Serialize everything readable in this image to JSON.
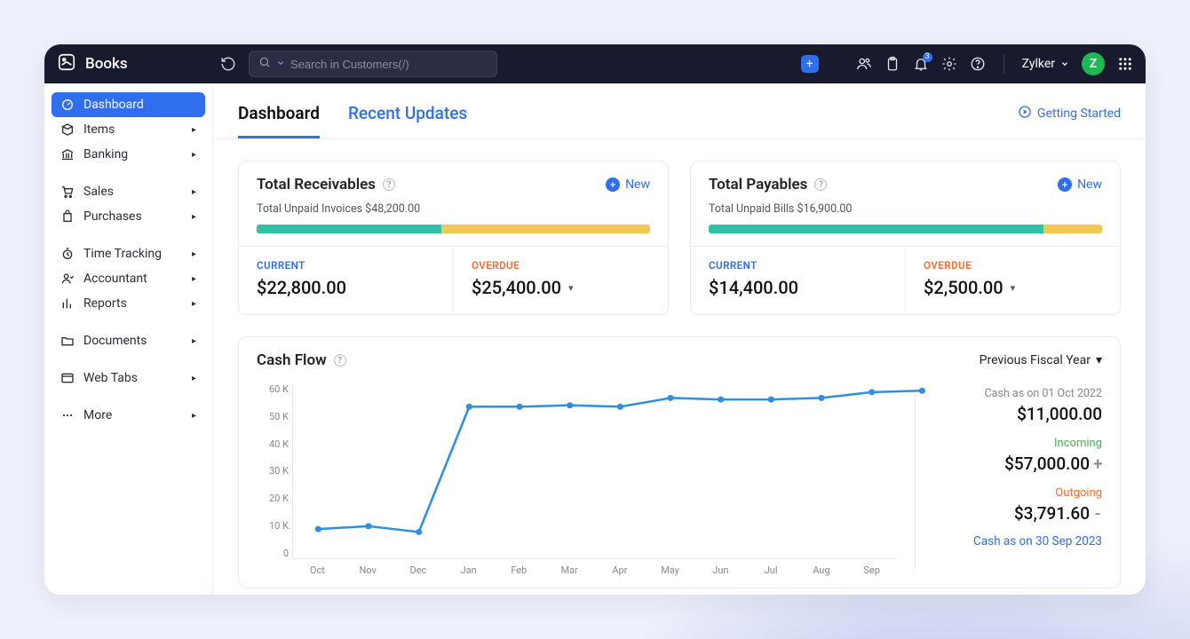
{
  "brand": {
    "name": "Books"
  },
  "search": {
    "placeholder": "Search in Customers(/)"
  },
  "header": {
    "org_name": "Zylker",
    "avatar_initial": "Z",
    "notification_count": "3"
  },
  "sidebar": {
    "groups": [
      {
        "items": [
          {
            "key": "dashboard",
            "label": "Dashboard",
            "expandable": false,
            "active": true
          },
          {
            "key": "items",
            "label": "Items",
            "expandable": true
          },
          {
            "key": "banking",
            "label": "Banking",
            "expandable": true
          }
        ]
      },
      {
        "items": [
          {
            "key": "sales",
            "label": "Sales",
            "expandable": true
          },
          {
            "key": "purchases",
            "label": "Purchases",
            "expandable": true
          }
        ]
      },
      {
        "items": [
          {
            "key": "time-tracking",
            "label": "Time Tracking",
            "expandable": true
          },
          {
            "key": "accountant",
            "label": "Accountant",
            "expandable": true
          },
          {
            "key": "reports",
            "label": "Reports",
            "expandable": true
          }
        ]
      },
      {
        "items": [
          {
            "key": "documents",
            "label": "Documents",
            "expandable": true
          }
        ]
      },
      {
        "items": [
          {
            "key": "web-tabs",
            "label": "Web Tabs",
            "expandable": true
          }
        ]
      },
      {
        "items": [
          {
            "key": "more",
            "label": "More",
            "expandable": true
          }
        ]
      }
    ]
  },
  "tabs": {
    "dashboard": "Dashboard",
    "recent_updates": "Recent Updates",
    "getting_started": "Getting Started"
  },
  "receivables": {
    "title": "Total Receivables",
    "new": "New",
    "sub_label": "Total Unpaid Invoices $48,200.00",
    "current_label": "CURRENT",
    "current_amount": "$22,800.00",
    "overdue_label": "OVERDUE",
    "overdue_amount": "$25,400.00",
    "current_pct": 47
  },
  "payables": {
    "title": "Total Payables",
    "new": "New",
    "sub_label": "Total Unpaid Bills $16,900.00",
    "current_label": "CURRENT",
    "current_amount": "$14,400.00",
    "overdue_label": "OVERDUE",
    "overdue_amount": "$2,500.00",
    "current_pct": 85
  },
  "cashflow": {
    "title": "Cash Flow",
    "period": "Previous Fiscal Year",
    "opening_caption": "Cash as on 01 Oct 2022",
    "opening_amount": "$11,000.00",
    "incoming_label": "Incoming",
    "incoming_amount": "$57,000.00",
    "outgoing_label": "Outgoing",
    "outgoing_amount": "$3,791.60",
    "closing_link": "Cash as on 30 Sep 2023"
  },
  "chart_data": {
    "type": "line",
    "title": "Cash Flow",
    "xlabel": "",
    "ylabel": "",
    "ylim": [
      0,
      60
    ],
    "y_unit": "K",
    "y_ticks": [
      "60 K",
      "50 K",
      "40 K",
      "30 K",
      "20 K",
      "10 K",
      "0"
    ],
    "categories": [
      "Oct",
      "Nov",
      "Dec",
      "Jan",
      "Feb",
      "Mar",
      "Apr",
      "May",
      "Jun",
      "Jul",
      "Aug",
      "Sep"
    ],
    "series": [
      {
        "name": "Cash",
        "values": [
          10,
          11,
          9,
          52,
          52,
          52.5,
          52,
          55,
          54.5,
          54.5,
          55,
          57,
          57.5
        ]
      }
    ]
  }
}
